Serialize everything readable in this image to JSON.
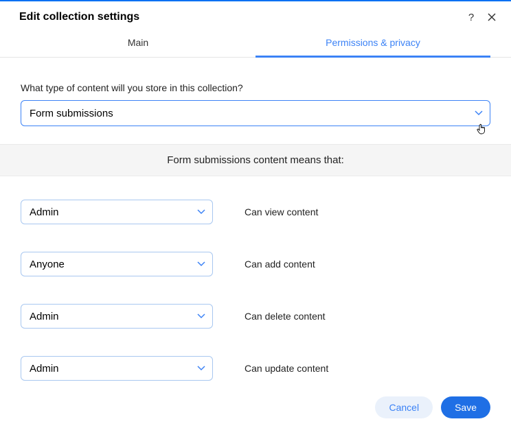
{
  "header": {
    "title": "Edit collection settings"
  },
  "tabs": {
    "main": "Main",
    "permissions": "Permissions & privacy"
  },
  "contentTypeQuestion": "What type of content will you store in this collection?",
  "contentTypeValue": "Form submissions",
  "banner": "Form submissions content means that:",
  "permissions": [
    {
      "role": "Admin",
      "label": "Can view content"
    },
    {
      "role": "Anyone",
      "label": "Can add content"
    },
    {
      "role": "Admin",
      "label": "Can delete content"
    },
    {
      "role": "Admin",
      "label": "Can update content"
    }
  ],
  "buttons": {
    "cancel": "Cancel",
    "save": "Save"
  }
}
